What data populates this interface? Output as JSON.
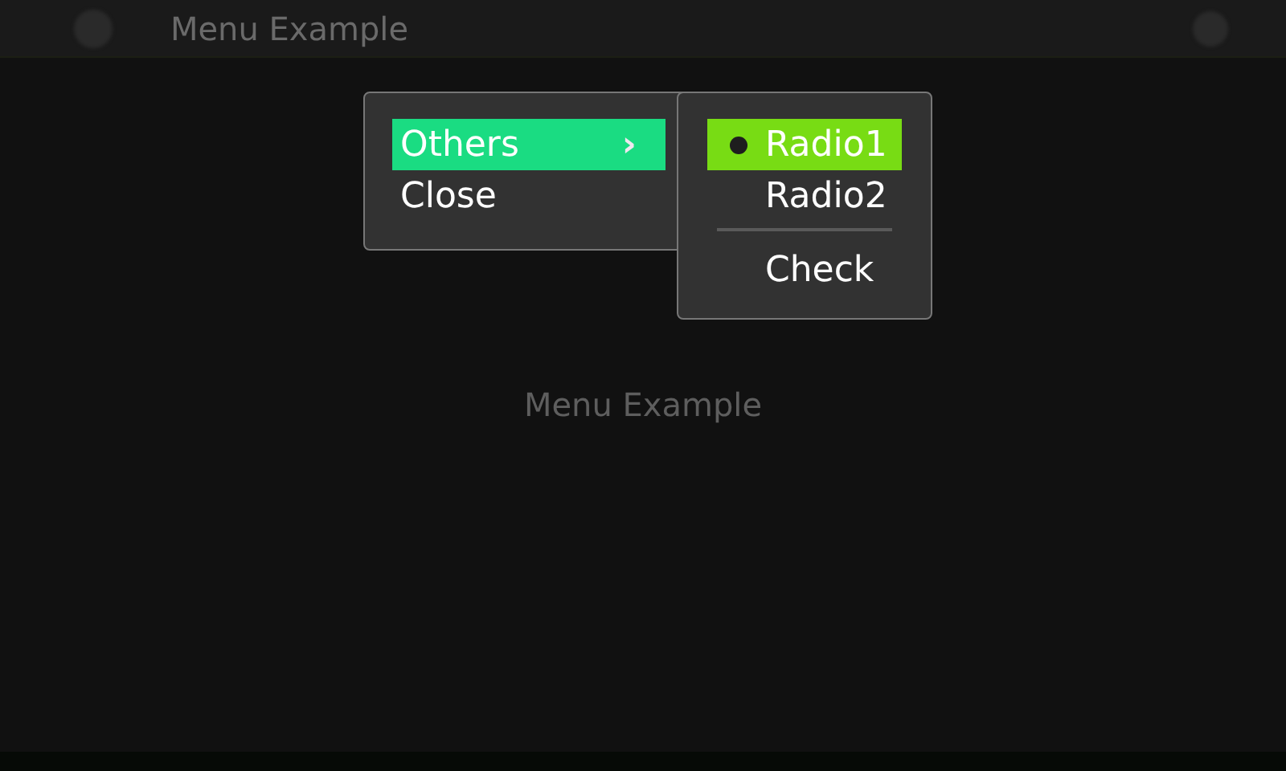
{
  "window": {
    "title": "Menu Example"
  },
  "content": {
    "label": "Menu Example"
  },
  "menu": {
    "items": [
      {
        "kind": "submenu",
        "label": "Others",
        "arrow": "›",
        "selected": true
      },
      {
        "kind": "action",
        "label": "Close",
        "selected": false
      }
    ]
  },
  "submenu": {
    "items": [
      {
        "kind": "radio",
        "label": "Radio1",
        "checked": true,
        "selected": true
      },
      {
        "kind": "radio",
        "label": "Radio2",
        "checked": false,
        "selected": false
      },
      {
        "kind": "separator"
      },
      {
        "kind": "check",
        "label": "Check",
        "checked": false,
        "selected": false
      }
    ]
  }
}
